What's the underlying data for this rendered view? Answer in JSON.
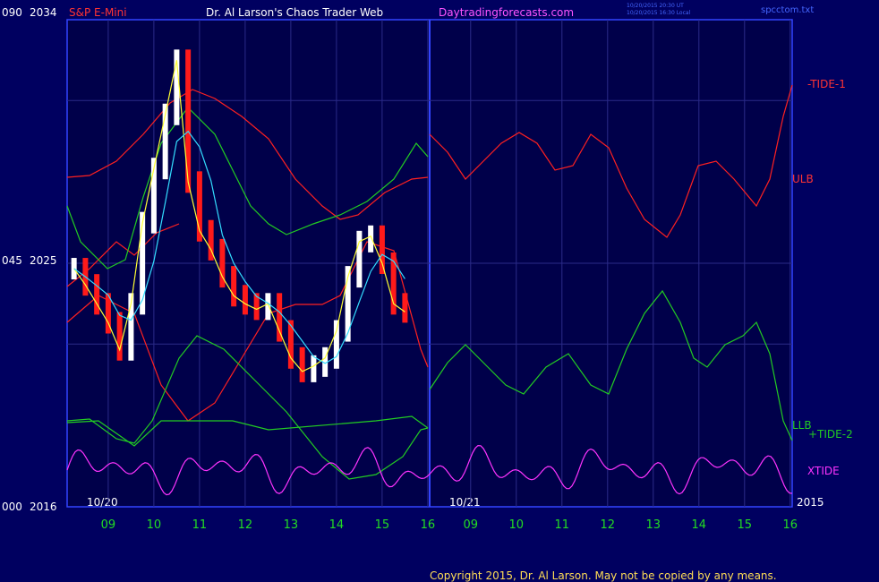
{
  "chart_data": {
    "type": "line",
    "header": {
      "left_code": "090",
      "left_price": "2034",
      "instrument": "S&P E-Mini",
      "title": "Dr. Al Larson's Chaos Trader Web",
      "website": "Daytradingforecasts.com",
      "timestamp_1": "10/20/2015 20:30 UT",
      "timestamp_2": "10/20/2015 16:30 Local",
      "filename": "spcctom.txt"
    },
    "y_axis": {
      "labels": [
        {
          "code": "090",
          "price": "2034",
          "value": 2034
        },
        {
          "code": "045",
          "price": "2025",
          "value": 2025
        },
        {
          "code": "000",
          "price": "2016",
          "value": 2016
        }
      ],
      "ylim": [
        2016,
        2034
      ]
    },
    "x_axis": {
      "ticks": [
        "09",
        "10",
        "11",
        "12",
        "13",
        "14",
        "15",
        "16",
        "09",
        "10",
        "11",
        "12",
        "13",
        "14",
        "15",
        "16"
      ],
      "date_labels": [
        "10/20",
        "10/21"
      ],
      "year": "2015"
    },
    "series": [
      {
        "name": "-TIDE-1",
        "color": "#ff2020"
      },
      {
        "name": "ULB",
        "color": "#ff2020"
      },
      {
        "name": "LLB",
        "color": "#22cc22"
      },
      {
        "name": "+TIDE-2",
        "color": "#22cc22"
      },
      {
        "name": "XTIDE",
        "color": "#ff33ff"
      }
    ],
    "price_bars_x": [
      8.25,
      8.5,
      8.75,
      9.0,
      9.25,
      9.5,
      9.75,
      10.0,
      10.25,
      10.5,
      10.75,
      11.0,
      11.25,
      11.5,
      11.75,
      12.0,
      12.25,
      12.5,
      12.75,
      13.0,
      13.25,
      13.5,
      13.75,
      14.0,
      14.25,
      14.5,
      14.75,
      15.0,
      15.25,
      15.5,
      15.75,
      16.0
    ],
    "price_bars_close": [
      2024.8,
      2024.2,
      2023.5,
      2022.8,
      2021.8,
      2023.5,
      2026.5,
      2028.5,
      2030.5,
      2032.5,
      2028.0,
      2026.2,
      2025.5,
      2024.5,
      2023.8,
      2023.5,
      2023.3,
      2023.5,
      2022.5,
      2021.5,
      2021.0,
      2021.2,
      2021.5,
      2022.5,
      2024.5,
      2025.8,
      2026.0,
      2025.0,
      2023.5,
      2023.2
    ],
    "copyright": "Copyright 2015, Dr. Al Larson. May not be copied by any means."
  }
}
